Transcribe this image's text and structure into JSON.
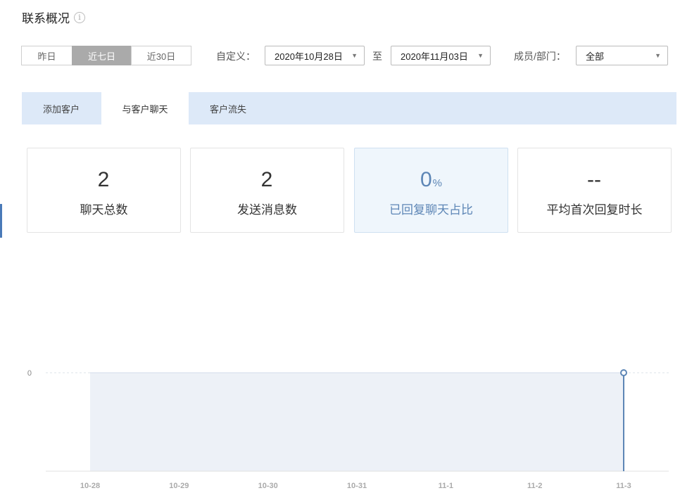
{
  "header": {
    "title": "联系概况",
    "info_icon": "i"
  },
  "date_range": {
    "buttons": [
      {
        "label": "昨日",
        "active": false
      },
      {
        "label": "近七日",
        "active": true
      },
      {
        "label": "近30日",
        "active": false
      }
    ],
    "custom_label": "自定义：",
    "start_date": "2020年10月28日",
    "separator": "至",
    "end_date": "2020年11月03日"
  },
  "member_filter": {
    "label": "成员/部门：",
    "value": "全部"
  },
  "tabs": [
    {
      "label": "添加客户",
      "active": false
    },
    {
      "label": "与客户聊天",
      "active": true
    },
    {
      "label": "客户流失",
      "active": false
    }
  ],
  "stats": [
    {
      "value": "2",
      "unit": "",
      "label": "聊天总数",
      "active": false
    },
    {
      "value": "2",
      "unit": "",
      "label": "发送消息数",
      "active": false
    },
    {
      "value": "0",
      "unit": "%",
      "label": "已回复聊天占比",
      "active": true
    },
    {
      "value": "--",
      "unit": "",
      "label": "平均首次回复时长",
      "active": false
    }
  ],
  "colors": {
    "accent": "#5d86b6",
    "tab_bar": "#dde9f8",
    "active_range": "#aaaaaa"
  },
  "chart_data": {
    "type": "area",
    "x": [
      "10-28",
      "10-29",
      "10-30",
      "10-31",
      "11-1",
      "11-2",
      "11-3"
    ],
    "series": [
      {
        "values": [
          0,
          0,
          0,
          0,
          0,
          0,
          0
        ]
      }
    ],
    "y_ticks": [
      "0"
    ],
    "ylim": [
      0,
      0
    ],
    "grid": true,
    "highlight_point": "11-3"
  }
}
